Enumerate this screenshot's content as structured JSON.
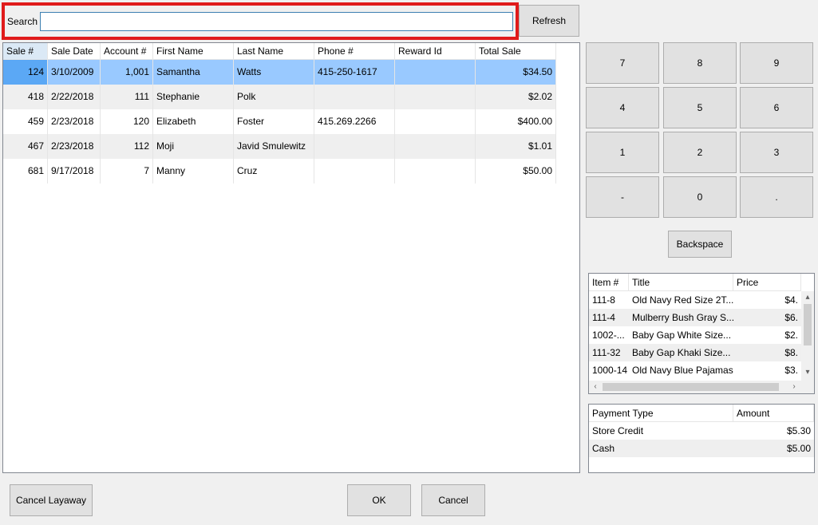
{
  "search": {
    "label": "Search",
    "value": "",
    "placeholder": ""
  },
  "refresh_label": "Refresh",
  "sales_grid": {
    "columns": [
      "Sale #",
      "Sale Date",
      "Account #",
      "First Name",
      "Last Name",
      "Phone #",
      "Reward Id",
      "Total Sale"
    ],
    "rows": [
      [
        "124",
        "3/10/2009",
        "1,001",
        "Samantha",
        "Watts",
        "415-250-1617",
        "",
        "$34.50"
      ],
      [
        "418",
        "2/22/2018",
        "111",
        "Stephanie",
        "Polk",
        "",
        "",
        "$2.02"
      ],
      [
        "459",
        "2/23/2018",
        "120",
        "Elizabeth",
        "Foster",
        "415.269.2266",
        "",
        "$400.00"
      ],
      [
        "467",
        "2/23/2018",
        "112",
        "Moji",
        "Javid Smulewitz",
        "",
        "",
        "$1.01"
      ],
      [
        "681",
        "9/17/2018",
        "7",
        "Manny",
        "Cruz",
        "",
        "",
        "$50.00"
      ]
    ],
    "selected_row": 0
  },
  "keypad": [
    "7",
    "8",
    "9",
    "4",
    "5",
    "6",
    "1",
    "2",
    "3",
    "-",
    "0",
    "."
  ],
  "backspace_label": "Backspace",
  "items_grid": {
    "columns": [
      "Item #",
      "Title",
      "Price"
    ],
    "rows": [
      [
        "111-8",
        "Old Navy Red Size 2T...",
        "$4."
      ],
      [
        "111-4",
        "Mulberry Bush Gray S...",
        "$6."
      ],
      [
        "1002-...",
        "Baby Gap White Size...",
        "$2."
      ],
      [
        "111-32",
        "Baby Gap Khaki Size...",
        "$8."
      ],
      [
        "1000-14",
        "Old Navy Blue Pajamas",
        "$3."
      ]
    ]
  },
  "payments_grid": {
    "columns": [
      "Payment Type",
      "Amount"
    ],
    "rows": [
      [
        "Store Credit",
        "$5.30"
      ],
      [
        "Cash",
        "$5.00"
      ]
    ]
  },
  "footer": {
    "cancel_layaway": "Cancel Layaway",
    "ok": "OK",
    "cancel": "Cancel"
  },
  "colors": {
    "highlight": "#e01b1b",
    "selection": "#99c9ff",
    "selection_cell": "#5ba8f5"
  }
}
